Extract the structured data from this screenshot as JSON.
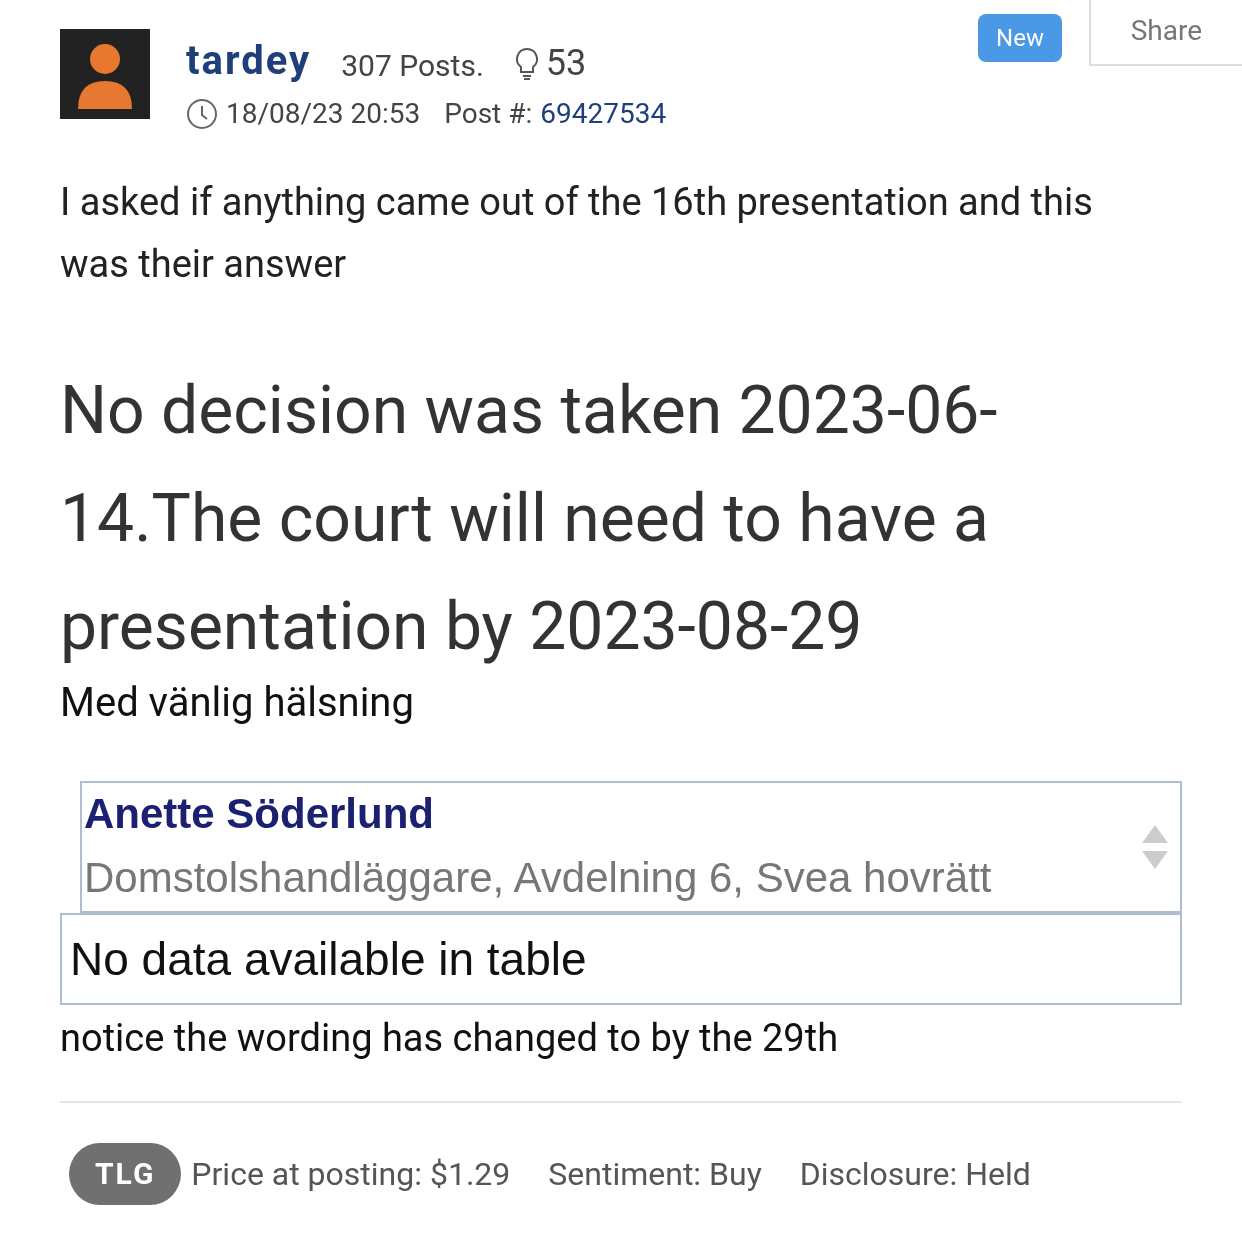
{
  "post": {
    "username": "tardey",
    "posts": "307 Posts.",
    "likes": "53",
    "timestamp": "18/08/23 20:53",
    "post_number_label": "Post #:",
    "post_number": "69427534",
    "new_badge": "New",
    "share": "Share"
  },
  "body": {
    "intro": "I asked if anything came out of the 16th presentation and this was their answer",
    "quote": "No decision was taken 2023-06-14.The court will need to have a presentation by 2023-08-29",
    "greeting": "Med vänlig hälsning",
    "signature": {
      "name": "Anette Söderlund",
      "title": "Domstolshandläggare, Avdelning 6, Svea hovrätt"
    },
    "empty_table": "No data available in table",
    "outro": "notice the wording has changed to by the 29th"
  },
  "footer": {
    "ticker": "TLG",
    "price": "Price at posting: $1.29",
    "sentiment": "Sentiment: Buy",
    "disclosure": "Disclosure: Held"
  }
}
